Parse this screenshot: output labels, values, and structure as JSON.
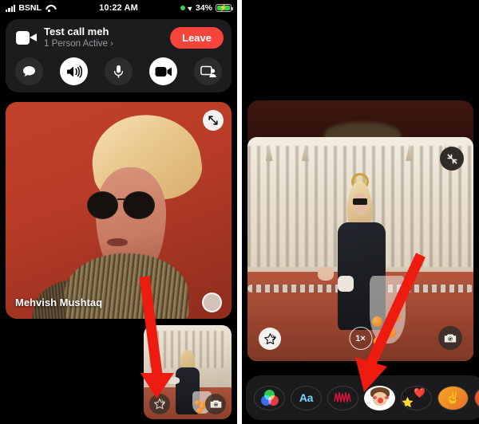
{
  "status_bar": {
    "carrier": "BSNL",
    "time": "10:22 AM",
    "battery_percent": "34%",
    "signal_icon": "cellular-bars-icon",
    "wifi_icon": "wifi-icon",
    "recording_dot_icon": "green-recording-dot-icon",
    "location_icon": "location-arrow-icon",
    "battery_icon": "battery-charging-icon"
  },
  "call_banner": {
    "video_icon": "video-camera-icon",
    "title": "Test call meh",
    "subtitle": "1 Person Active",
    "chevron": "›",
    "leave_label": "Leave",
    "controls": [
      {
        "name": "chat-button",
        "icon": "chat-bubble-icon",
        "active": false
      },
      {
        "name": "speaker-button",
        "icon": "speaker-icon",
        "active": true
      },
      {
        "name": "microphone-button",
        "icon": "microphone-icon",
        "active": false
      },
      {
        "name": "camera-button",
        "icon": "video-camera-icon",
        "active": true
      },
      {
        "name": "share-screen-button",
        "icon": "share-screen-icon",
        "active": false
      }
    ]
  },
  "left_panel": {
    "main_video": {
      "participant_name": "Mehvish Mushtaq",
      "expand_icon": "expand-diagonal-arrows-icon",
      "shutter_icon": "shutter-capture-icon"
    },
    "pip": {
      "effects_icon": "star-effects-icon",
      "flip_camera_icon": "camera-flip-icon"
    },
    "annotation_arrow": "red-arrow-pointing-to-effects-button"
  },
  "right_panel": {
    "photo": {
      "shrink_icon": "shrink-diagonal-arrows-icon",
      "effects_icon": "star-effects-icon",
      "zoom_level": "1×",
      "flip_camera_icon": "camera-flip-icon"
    },
    "effects_tray": [
      {
        "name": "filters-effect",
        "icon": "rgb-circles-icon",
        "label": "",
        "selected": false
      },
      {
        "name": "text-effect",
        "icon": "text-aa-icon",
        "label": "Aa",
        "selected": false
      },
      {
        "name": "doodle-effect",
        "icon": "scribble-doodle-icon",
        "label": "",
        "selected": false
      },
      {
        "name": "memoji-effect",
        "icon": "memoji-avatar-icon",
        "label": "",
        "selected": true
      },
      {
        "name": "stickers-effect",
        "icon": "stickers-icon",
        "label": "🏳❤️⭐",
        "selected": false
      },
      {
        "name": "gesture-effect",
        "icon": "peace-hand-icon",
        "label": "✌",
        "selected": false
      },
      {
        "name": "more-effects",
        "icon": "more-effects-icon",
        "label": "👤",
        "selected": false
      }
    ],
    "annotation_arrow": "red-arrow-pointing-to-memoji-effect"
  },
  "colors": {
    "accent_red": "#f8453c",
    "arrow_red": "#ee1b11",
    "card_bg": "#1c1c1e",
    "control_bg": "#2c2c2e",
    "battery_green": "#3ad24a"
  }
}
